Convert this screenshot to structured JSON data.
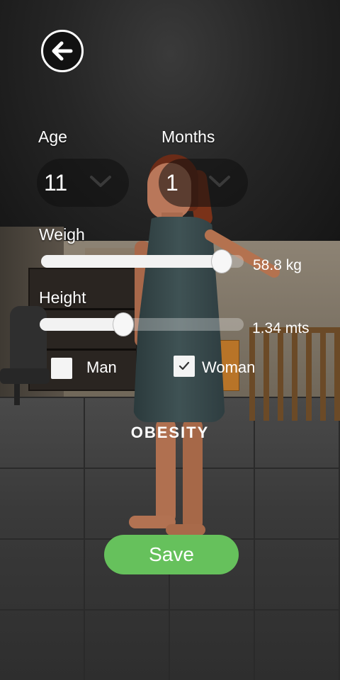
{
  "age": {
    "label": "Age",
    "value": "11"
  },
  "months": {
    "label": "Months",
    "value": "1"
  },
  "weight": {
    "label": "Weigh",
    "value_text": "58.8 kg",
    "level": 0.89
  },
  "height": {
    "label": "Height",
    "value_text": "1.34 mts",
    "level": 0.41
  },
  "gender": {
    "man_label": "Man",
    "man_checked": false,
    "woman_label": "Woman",
    "woman_checked": true
  },
  "status_text": "OBESITY",
  "save_label": "Save",
  "colors": {
    "save": "#66c15c",
    "track": "#f2f2f2"
  },
  "icons": {
    "back": "arrow-left-icon",
    "dropdown": "chevron-down-icon",
    "check": "checkmark-icon"
  }
}
